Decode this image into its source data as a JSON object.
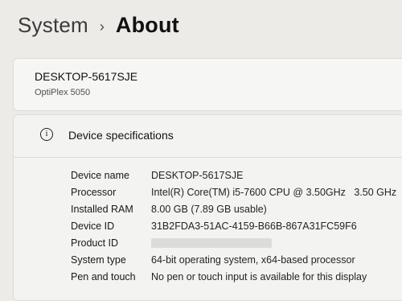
{
  "header": {
    "parent": "System",
    "separator": "›",
    "current": "About"
  },
  "device_card": {
    "name": "DESKTOP-5617SJE",
    "model": "OptiPlex 5050"
  },
  "specifications": {
    "title": "Device specifications",
    "rows": [
      {
        "label": "Device name",
        "value": "DESKTOP-5617SJE"
      },
      {
        "label": "Processor",
        "value": "Intel(R) Core(TM) i5-7600 CPU @ 3.50GHz   3.50 GHz"
      },
      {
        "label": "Installed RAM",
        "value": "8.00 GB (7.89 GB usable)"
      },
      {
        "label": "Device ID",
        "value": "31B2FDA3-51AC-4159-B66B-867A31FC59F6"
      },
      {
        "label": "Product ID",
        "value": ""
      },
      {
        "label": "System type",
        "value": "64-bit operating system, x64-based processor"
      },
      {
        "label": "Pen and touch",
        "value": "No pen or touch input is available for this display"
      }
    ]
  }
}
